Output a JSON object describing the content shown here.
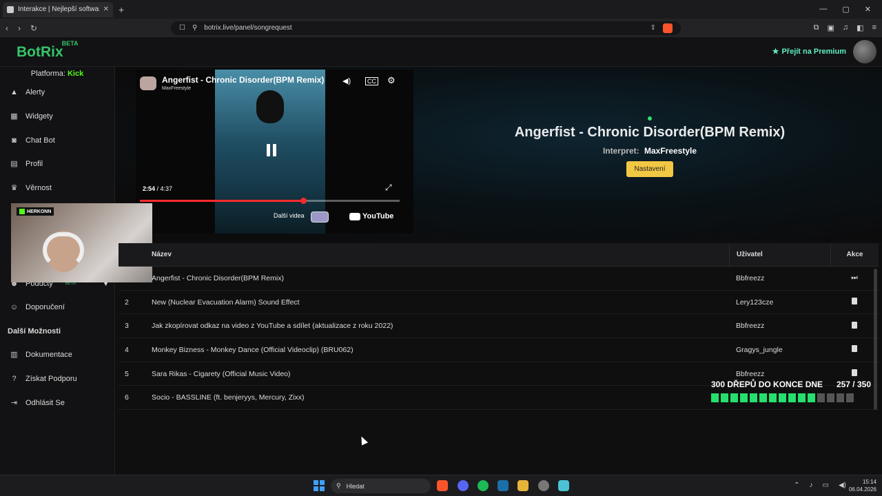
{
  "browser": {
    "tab_title": "Interakce | Nejlepší software",
    "new_tab": "+",
    "url": "botrix.live/panel/songrequest",
    "window_controls": [
      "—",
      "▢",
      "✕"
    ]
  },
  "header": {
    "logo": "BotRix",
    "logo_badge": "BETA",
    "premium_label": "Přejít na Premium"
  },
  "sidebar": {
    "platform_label": "Platforma:",
    "platform_value": "Kick",
    "items": [
      {
        "label": "Alerty",
        "icon": "warning-icon"
      },
      {
        "label": "Widgety",
        "icon": "widgets-icon"
      },
      {
        "label": "Chat Bot",
        "icon": "robot-icon"
      },
      {
        "label": "Profil",
        "icon": "profile-icon"
      },
      {
        "label": "Věrnost",
        "icon": "trophy-icon"
      }
    ],
    "podcasts_label": "Podúčty",
    "podcasts_badge": "BETA",
    "referral_label": "Doporučení",
    "section_more": "Další Možnosti",
    "more_items": [
      {
        "label": "Dokumentace",
        "icon": "docs-icon"
      },
      {
        "label": "Získat Podporu",
        "icon": "help-icon"
      },
      {
        "label": "Odhlásit Se",
        "icon": "logout-icon"
      }
    ]
  },
  "player": {
    "video_title": "Angerfist - Chronic Disorder(BPM Remix)",
    "channel": "MaxFreestyle",
    "time_current": "2:54",
    "time_total": "4:37",
    "progress": 0.628,
    "more_videos": "Další videa",
    "youtube_label": "YouTube"
  },
  "now_playing": {
    "title": "Angerfist - Chronic Disorder(BPM Remix)",
    "artist_label": "Interpret:",
    "artist": "MaxFreestyle",
    "settings_button": "Nastavení"
  },
  "webcam": {
    "badge": "HERKONN"
  },
  "table": {
    "headers": {
      "num": "",
      "name": "Název",
      "user": "Uživatel",
      "action": "Akce"
    },
    "rows": [
      {
        "num": "",
        "name": "Angerfist - Chronic Disorder(BPM Remix)",
        "user": "Bbfreezz",
        "action": "skip"
      },
      {
        "num": "2",
        "name": "New (Nuclear Evacuation Alarm) Sound Effect",
        "user": "Lery123cze",
        "action": "delete"
      },
      {
        "num": "3",
        "name": "Jak zkopírovat odkaz na video z YouTube a sdílet (aktualizace z roku 2022)",
        "user": "Bbfreezz",
        "action": "delete"
      },
      {
        "num": "4",
        "name": "Monkey Bizness - Monkey Dance (Official Videoclip) (BRU062)",
        "user": "Gragys_jungle",
        "action": "delete"
      },
      {
        "num": "5",
        "name": "Sara Rikas - Cigarety (Official Music Video)",
        "user": "Bbfreezz",
        "action": "delete"
      },
      {
        "num": "6",
        "name": "Socio - BASSLINE (ft. benjeryys, Mercury, Zixx)",
        "user": "",
        "action": ""
      }
    ]
  },
  "goal": {
    "label": "300 DŘEPŮ DO KONCE DNE",
    "progress_text": "257 / 350",
    "segments_total": 15,
    "segments_on": 11
  },
  "taskbar": {
    "search_label": "Hledat",
    "time": "15:14",
    "date": "06.04.2026"
  }
}
